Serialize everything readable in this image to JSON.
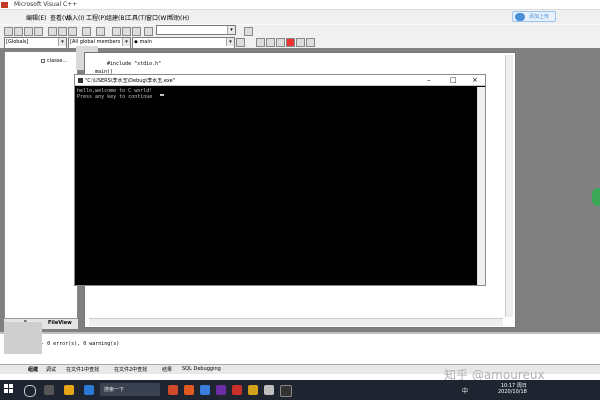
{
  "window": {
    "title": "Microsoft Visual C++"
  },
  "menu": [
    "编辑(E)",
    "查看(V)",
    "插入(I)",
    "工程(P)",
    "组建(B)",
    "工具(T)",
    "窗口(W)",
    "帮助(H)"
  ],
  "cloud_button": {
    "label": "添加上传"
  },
  "toolbar2": {
    "globals_combo": "[Globals]",
    "members_combo": "[All global members",
    "function_combo": "main"
  },
  "class_tree": {
    "root_label": "classe..."
  },
  "left_tabs": {
    "fileview": "FileView",
    "classview": "F..."
  },
  "editor": {
    "line1": "#include \"stdio.h\"",
    "line2": "main()"
  },
  "console": {
    "title": "\"C:\\USERS\\李水玉\\Debug\\李水玉.exe\"",
    "line1": "hello,welcome to C world!",
    "line2": "Press any key to continue"
  },
  "output": {
    "text": ".exe - 0 error(s), 0 warning(s)"
  },
  "output_tabs": [
    "组建",
    "调试",
    "在文件1中查找",
    "在文件2中查找",
    "结果",
    "SQL Debugging"
  ],
  "watermark": "知乎 @amoureux",
  "taskbar": {
    "search_text": "搜索一下",
    "ime": "中",
    "time": "10:17 周日",
    "date": "2020/10/18"
  },
  "colors": {
    "workspace_gray": "#808080",
    "console_bg": "#000000",
    "taskbar_bg": "#1f2530"
  }
}
